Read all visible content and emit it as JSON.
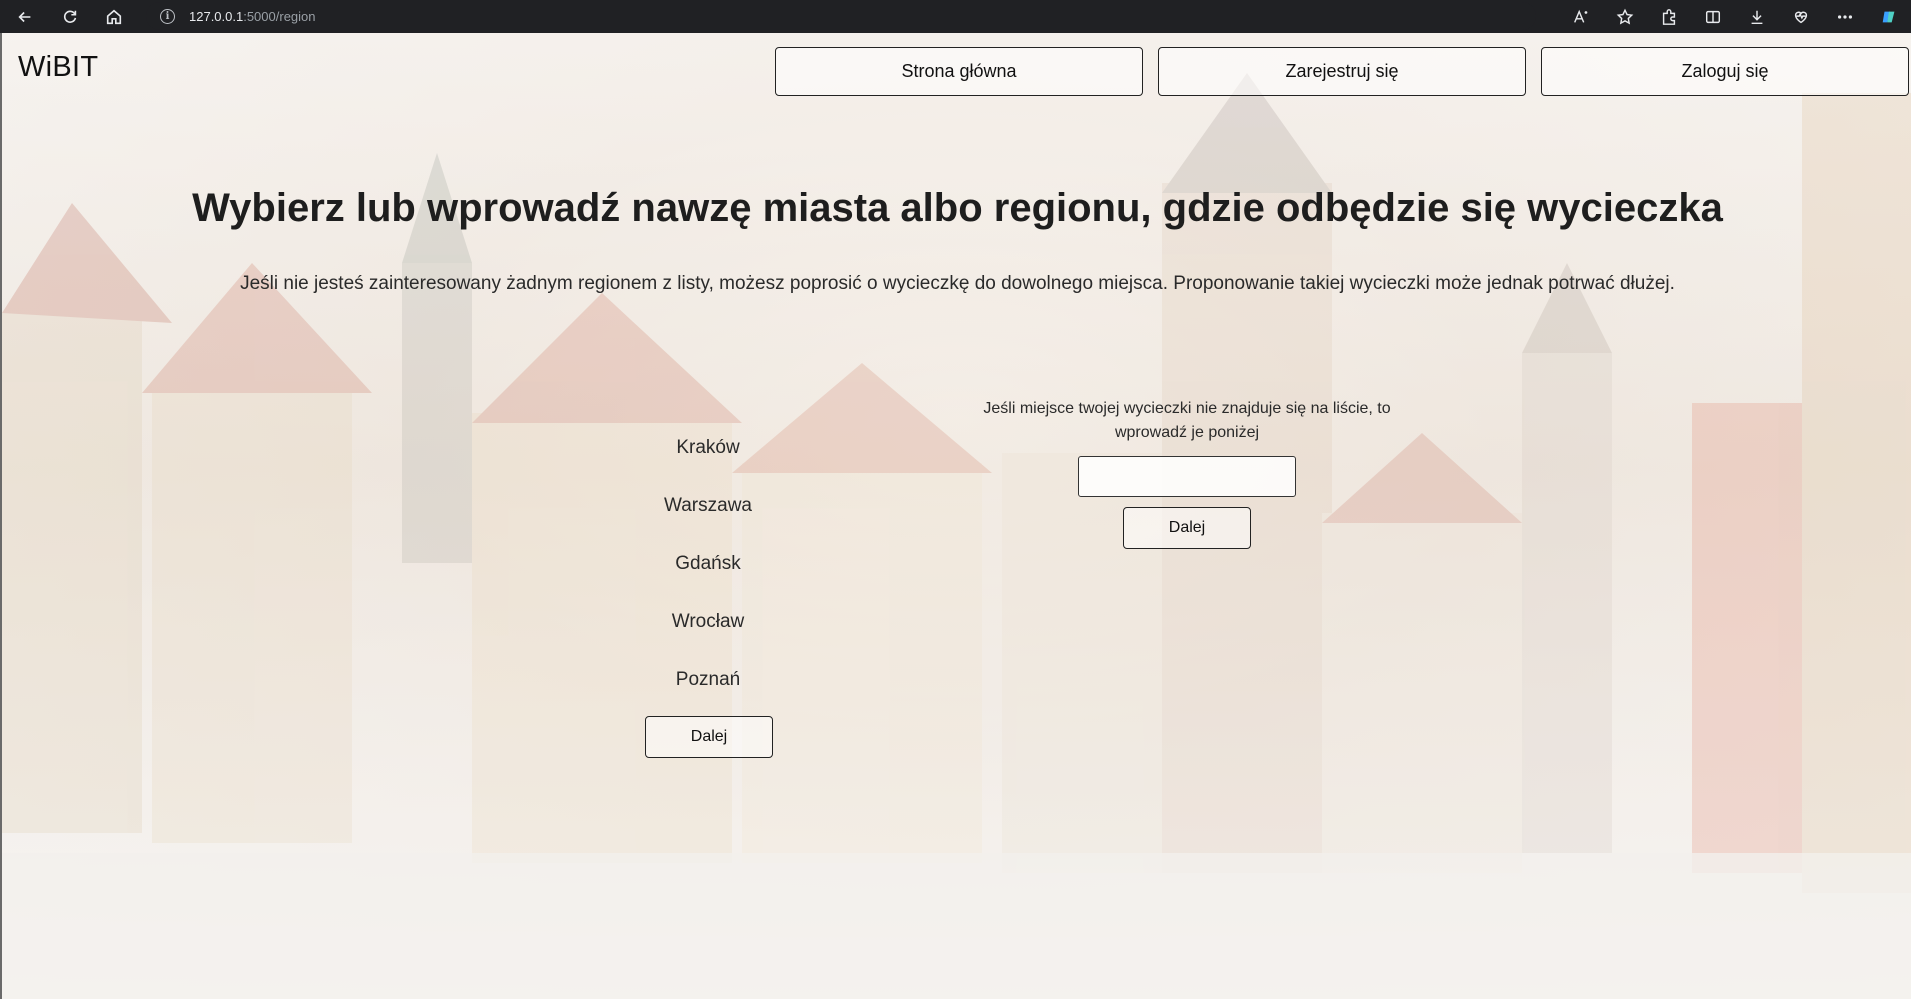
{
  "browser": {
    "url_host": "127.0.0.1",
    "url_path": ":5000/region"
  },
  "header": {
    "logo": "WiBIT",
    "nav": [
      {
        "label": "Strona główna"
      },
      {
        "label": "Zarejestruj się"
      },
      {
        "label": "Zaloguj się"
      }
    ]
  },
  "main": {
    "title": "Wybierz lub wprowadź nawzę miasta albo regionu, gdzie odbędzie się wycieczka",
    "subtitle": "Jeśli nie jesteś zainteresowany żadnym regionem z listy, możesz poprosić o wycieczkę do dowolnego miejsca. Proponowanie takiej wycieczki może jednak potrwać dłużej.",
    "regions": [
      "Kraków",
      "Warszawa",
      "Gdańsk",
      "Wrocław",
      "Poznań"
    ],
    "list_next_label": "Dalej",
    "custom_hint": "Jeśli miejsce twojej wycieczki nie znajduje się na liście, to wprowadź je poniżej",
    "custom_input_value": "",
    "custom_next_label": "Dalej"
  }
}
